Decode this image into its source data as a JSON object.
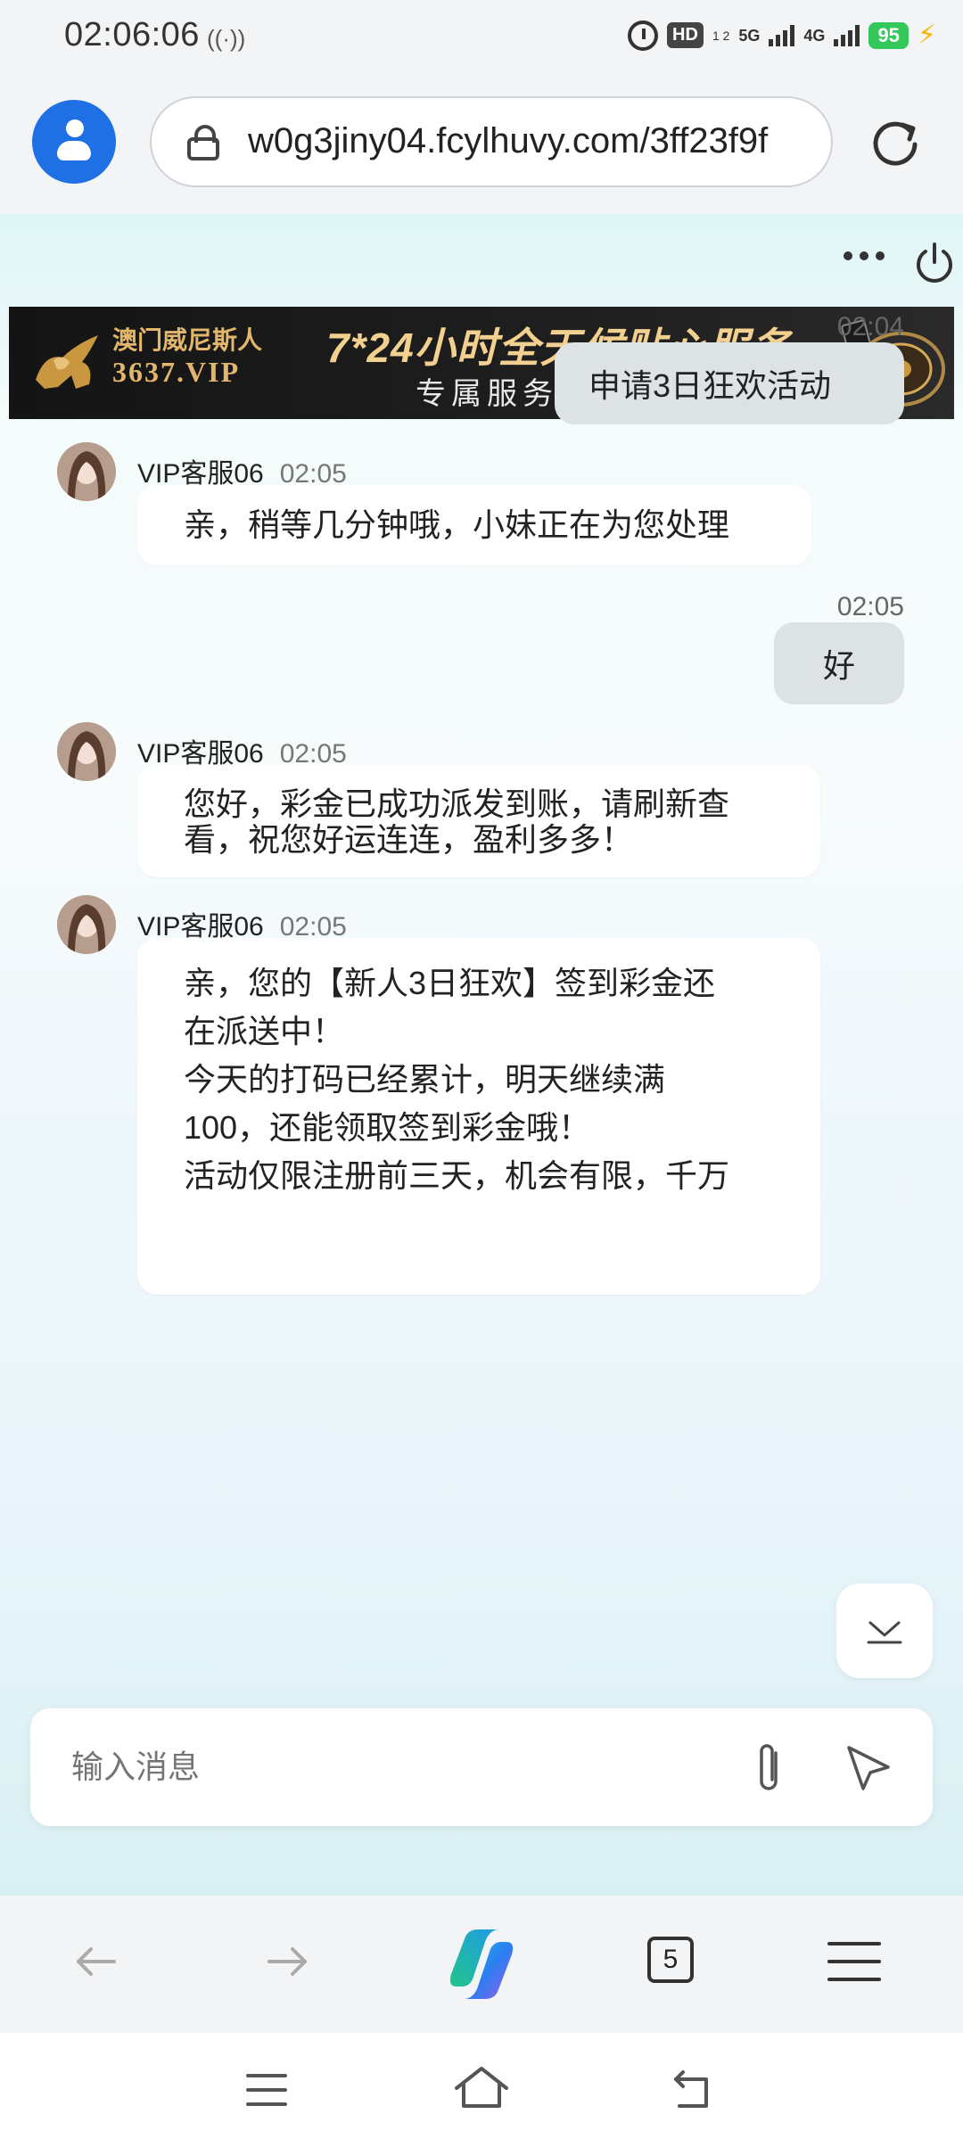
{
  "status_bar": {
    "time": "02:06:06",
    "cast_icon": "hotspot-icon",
    "hd": "HD",
    "hd_sub": "1 2",
    "net1": "5G",
    "net2": "4G",
    "battery": "95"
  },
  "browser": {
    "url": "w0g3jiny04.fcylhuvy.com/3ff23f9f",
    "tab_count": "5"
  },
  "banner": {
    "brand_line1": "澳门威尼斯人",
    "brand_line2": "3637.VIP",
    "slogan": "7*24小时全天候贴心服务",
    "subtitle": "专属服务 · 尊享体验"
  },
  "messages": [
    {
      "side": "right",
      "time": "02:04",
      "text": "申请3日狂欢活动"
    },
    {
      "side": "left",
      "sender": "VIP客服06",
      "time": "02:05",
      "text": "亲，稍等几分钟哦，小妹正在为您处理"
    },
    {
      "side": "right",
      "time": "02:05",
      "text": "好"
    },
    {
      "side": "left",
      "sender": "VIP客服06",
      "time": "02:05",
      "lines": [
        "您好，彩金已成功派发到账，请刷新查",
        "看，祝您好运连连，盈利多多！"
      ]
    },
    {
      "side": "left",
      "sender": "VIP客服06",
      "time": "02:05",
      "lines": [
        "亲，您的【新人3日狂欢】签到彩金还",
        "在派送中！",
        "今天的打码已经累计，明天继续满",
        "100，还能领取签到彩金哦！",
        "活动仅限注册前三天，机会有限，千万"
      ]
    }
  ],
  "input": {
    "placeholder": "输入消息"
  }
}
